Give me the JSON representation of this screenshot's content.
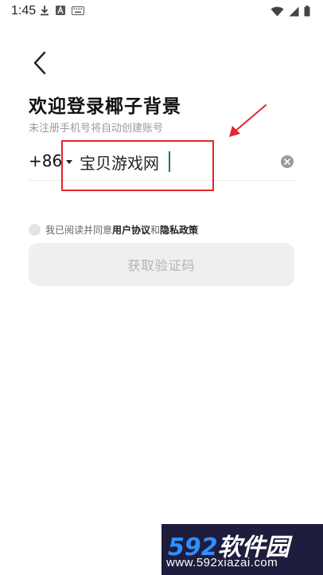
{
  "status_bar": {
    "time": "1:45",
    "left_icons": [
      "download-icon",
      "a-badge-icon",
      "keyboard-icon"
    ],
    "right_icons": [
      "wifi-icon",
      "signal-icon",
      "battery-icon"
    ]
  },
  "header": {
    "title": "欢迎登录椰子背景",
    "subtitle": "未注册手机号将自动创建账号"
  },
  "phone": {
    "country_code": "+86",
    "value": "宝贝游戏网"
  },
  "agreement": {
    "prefix": "我已阅读并同意",
    "user_agreement": "用户协议",
    "and": "和",
    "privacy_policy": "隐私政策"
  },
  "button": {
    "get_code_label": "获取验证码"
  },
  "watermark": {
    "brand_num": "592",
    "brand_cn": "软件园",
    "url": "www.592xiazai.com"
  },
  "colors": {
    "annotation": "#e5252a",
    "cursor": "#1c7c4a",
    "button_bg": "#efefef",
    "button_text": "#b3b3b3"
  }
}
